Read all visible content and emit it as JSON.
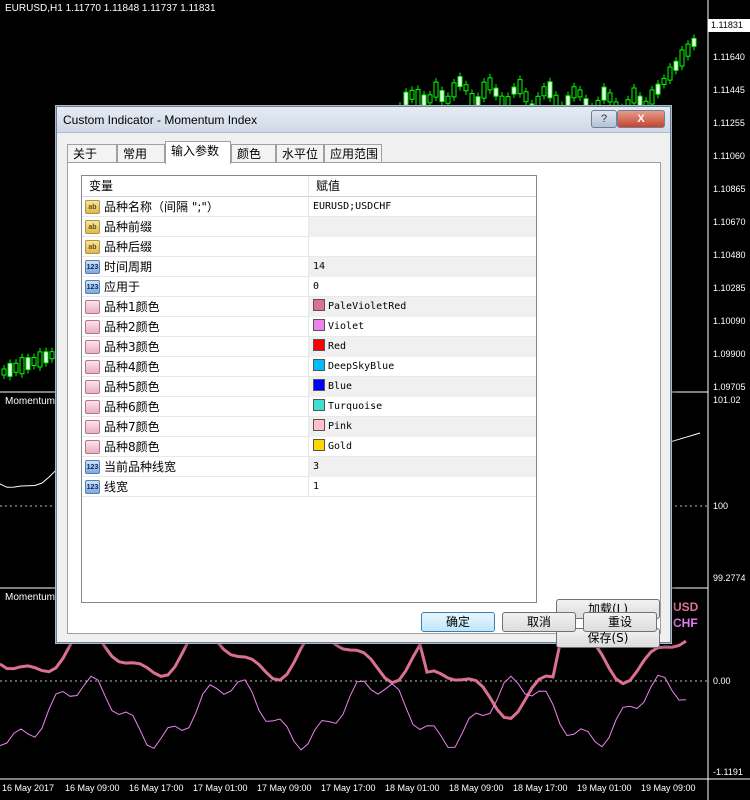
{
  "chart": {
    "symbol_header": "EURUSD,H1  1.11770 1.11848 1.11737 1.11831",
    "current_price": "1.11831",
    "price_labels": [
      "1.11640",
      "1.11445",
      "1.11255",
      "1.11060",
      "1.10865",
      "1.10670",
      "1.10480",
      "1.10285",
      "1.10090",
      "1.09900",
      "1.09705"
    ],
    "pane1_title": "Momentum",
    "pane1_labels": [
      "101.02",
      "100",
      "99.2774"
    ],
    "pane2_title": "Momentum",
    "pane2_labels": [
      "0.00",
      "-1.1191"
    ],
    "time_labels": [
      "16 May 2017",
      "16 May 09:00",
      "16 May 17:00",
      "17 May 01:00",
      "17 May 09:00",
      "17 May 17:00",
      "18 May 01:00",
      "18 May 09:00",
      "18 May 17:00",
      "19 May 01:00",
      "19 May 09:00"
    ],
    "overlay_symbols": [
      {
        "text": "USD",
        "color": "#d8739a"
      },
      {
        "text": "CHF",
        "color": "#e27ee8"
      }
    ]
  },
  "dialog": {
    "title": "Custom Indicator - Momentum Index",
    "help_label": "?",
    "close_label": "X",
    "tabs": [
      "关于",
      "常用",
      "输入参数",
      "颜色",
      "水平位",
      "应用范围"
    ],
    "active_tab": 2,
    "table": {
      "header_var": "变量",
      "header_val": "赋值",
      "rows": [
        {
          "type": "ab",
          "name": "品种名称（间隔 \";\"）",
          "value": "EURUSD;USDCHF",
          "gray": false
        },
        {
          "type": "ab",
          "name": "品种前缀",
          "value": "",
          "gray": true
        },
        {
          "type": "ab",
          "name": "品种后缀",
          "value": "",
          "gray": false
        },
        {
          "type": "123",
          "name": "时间周期",
          "value": "14",
          "gray": true
        },
        {
          "type": "123",
          "name": "应用于",
          "value": "0",
          "gray": false
        },
        {
          "type": "clr",
          "name": "品种1颜色",
          "value": "PaleVioletRed",
          "color": "#db7093",
          "gray": true
        },
        {
          "type": "clr",
          "name": "品种2颜色",
          "value": "Violet",
          "color": "#ee82ee",
          "gray": false
        },
        {
          "type": "clr",
          "name": "品种3颜色",
          "value": "Red",
          "color": "#ff0000",
          "gray": true
        },
        {
          "type": "clr",
          "name": "品种4颜色",
          "value": "DeepSkyBlue",
          "color": "#00bfff",
          "gray": false
        },
        {
          "type": "clr",
          "name": "品种5颜色",
          "value": "Blue",
          "color": "#0000ff",
          "gray": true
        },
        {
          "type": "clr",
          "name": "品种6颜色",
          "value": "Turquoise",
          "color": "#40e0d0",
          "gray": false
        },
        {
          "type": "clr",
          "name": "品种7颜色",
          "value": "Pink",
          "color": "#ffc0cb",
          "gray": true
        },
        {
          "type": "clr",
          "name": "品种8颜色",
          "value": "Gold",
          "color": "#ffd700",
          "gray": false
        },
        {
          "type": "123",
          "name": "当前品种线宽",
          "value": "3",
          "gray": true
        },
        {
          "type": "123",
          "name": "线宽",
          "value": "1",
          "gray": false
        }
      ]
    },
    "load_label": "加载(L)",
    "save_label": "保存(S)",
    "ok_label": "确定",
    "cancel_label": "取消",
    "reset_label": "重设"
  }
}
